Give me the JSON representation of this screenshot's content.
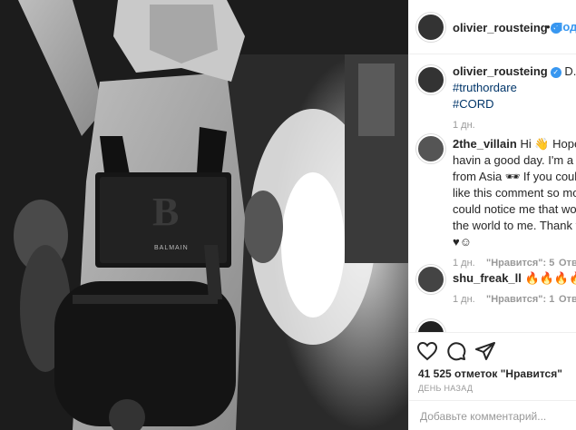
{
  "post": {
    "image_alt": "Black and white photo of a model with Balmain bags",
    "brand_text": "BALMAIN",
    "brand_letter": "B"
  },
  "header": {
    "username": "olivier_rousteing",
    "dot": "•",
    "follow_label": "Подп"
  },
  "caption": {
    "username": "olivier_rousteing",
    "text": "D.A.R.I",
    "hashtags": [
      "#truthordare",
      "#CORD"
    ],
    "time": "1 дн."
  },
  "comments": [
    {
      "username": "2the_villain",
      "lines": [
        "Hi 👋 Hope yo",
        "havin a good day. I'm a rap",
        "from Asia 🕶 If you could s",
        "like this comment so more",
        "could notice me that would",
        "the world to me. Thank yo",
        "♥☺"
      ],
      "time": "1 дн.",
      "likes": "\"Нравится\": 5",
      "reply": "Отве"
    },
    {
      "username": "shu_freak_ll",
      "text": "🔥🔥🔥🔥❤",
      "time": "1 дн.",
      "likes": "\"Нравится\": 1",
      "reply": "Отве"
    }
  ],
  "likes_text": "41 525 отметок \"Нравится\"",
  "date_text": "ДЕНЬ НАЗАД",
  "add_comment_placeholder": "Добавьте комментарий...",
  "icons": [
    "heart-icon",
    "comment-icon",
    "share-icon",
    "verified-icon"
  ],
  "colors": {
    "link": "#003569",
    "accent": "#3897f0",
    "text": "#262626",
    "muted": "#999999"
  }
}
